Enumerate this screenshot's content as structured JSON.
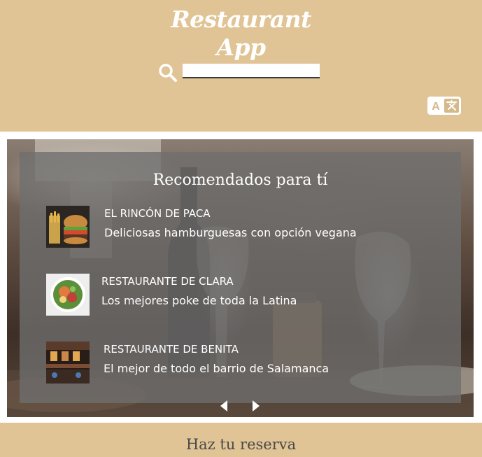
{
  "app": {
    "title_line1": "Restaurant",
    "title_line2": "App"
  },
  "search": {
    "value": "",
    "placeholder": "",
    "icon": "search-icon"
  },
  "translate_icon": "translate-icon",
  "carousel": {
    "title": "Recomendados para tí",
    "items": [
      {
        "name": "EL RINCÓN DE PACA",
        "description": "Deliciosas hamburguesas con opción vegana",
        "image": "burger-fries-photo"
      },
      {
        "name": "RESTAURANTE DE CLARA",
        "description": "Los mejores poke de toda la Latina",
        "image": "poke-bowl-photo"
      },
      {
        "name": "RESTAURANTE DE BENITA",
        "description": "El mejor de todo el barrio de Salamanca",
        "image": "restaurant-interior-photo"
      }
    ],
    "prev_icon": "caret-left-icon",
    "next_icon": "caret-right-icon"
  },
  "footer": {
    "reserve_label": "Haz tu reserva"
  },
  "colors": {
    "header_bg": "#e0c495",
    "panel_overlay": "#6e6e6e",
    "text_light": "#ffffff",
    "footer_text": "#4a4a4a"
  }
}
